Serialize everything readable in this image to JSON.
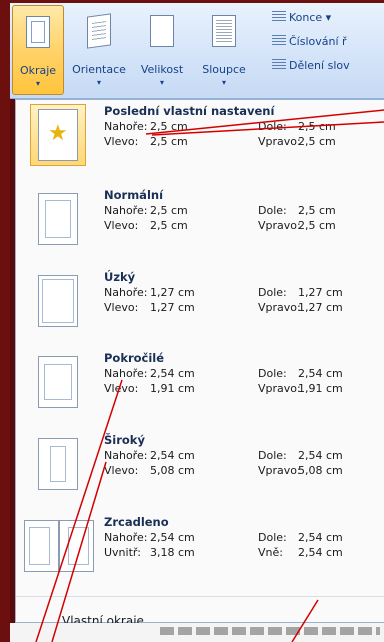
{
  "ribbon": {
    "buttons": [
      {
        "label": "Okraje",
        "arrow": "▾"
      },
      {
        "label": "Orientace",
        "arrow": "▾"
      },
      {
        "label": "Velikost",
        "arrow": "▾"
      },
      {
        "label": "Sloupce",
        "arrow": "▾"
      }
    ],
    "small_items": [
      {
        "label": "Konce ▾",
        "icon": "breaks-icon"
      },
      {
        "label": "Číslování ř",
        "icon": "line-numbers-icon"
      },
      {
        "label": "Dělení slov",
        "icon": "hyphenation-icon"
      }
    ]
  },
  "margins": {
    "items": [
      {
        "name": "Poslední vlastní nastavení",
        "r1": [
          "Nahoře:",
          "2,5 cm",
          "Dole:",
          "2,5 cm"
        ],
        "r2": [
          "Vlevo:",
          "2,5 cm",
          "Vpravo:",
          "2,5 cm"
        ],
        "selected": true
      },
      {
        "name": "Normální",
        "r1": [
          "Nahoře:",
          "2,5 cm",
          "Dole:",
          "2,5 cm"
        ],
        "r2": [
          "Vlevo:",
          "2,5 cm",
          "Vpravo:",
          "2,5 cm"
        ]
      },
      {
        "name": "Úzký",
        "r1": [
          "Nahoře:",
          "1,27 cm",
          "Dole:",
          "1,27 cm"
        ],
        "r2": [
          "Vlevo:",
          "1,27 cm",
          "Vpravo:",
          "1,27 cm"
        ]
      },
      {
        "name": "Pokročilé",
        "r1": [
          "Nahoře:",
          "2,54 cm",
          "Dole:",
          "2,54 cm"
        ],
        "r2": [
          "Vlevo:",
          "1,91 cm",
          "Vpravo:",
          "1,91 cm"
        ]
      },
      {
        "name": "Široký",
        "r1": [
          "Nahoře:",
          "2,54 cm",
          "Dole:",
          "2,54 cm"
        ],
        "r2": [
          "Vlevo:",
          "5,08 cm",
          "Vpravo:",
          "5,08 cm"
        ]
      },
      {
        "name": "Zrcadleno",
        "r1": [
          "Nahoře:",
          "2,54 cm",
          "Dole:",
          "2,54 cm"
        ],
        "r2": [
          "Uvnitř:",
          "3,18 cm",
          "Vně:",
          "2,54 cm"
        ]
      }
    ],
    "custom_label": "Vlastní okraje..."
  },
  "colors": {
    "frame": "#6b0f0f",
    "callout": "#cc0000",
    "selected": "#ffd775"
  }
}
